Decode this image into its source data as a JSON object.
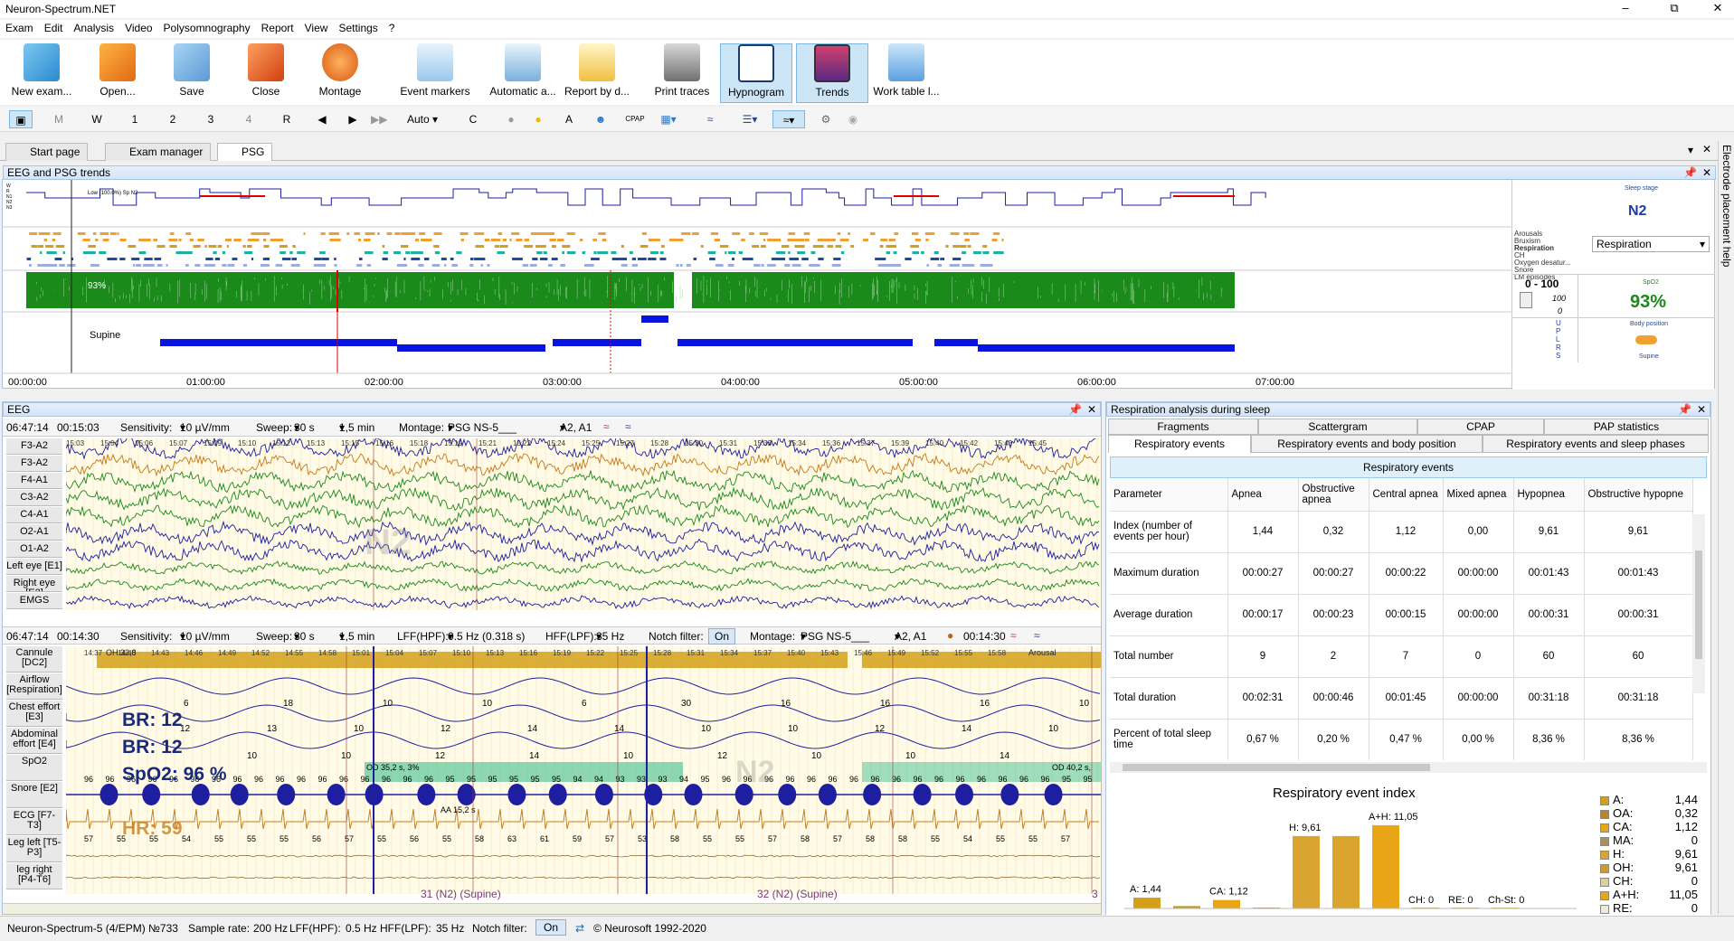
{
  "app": {
    "title": "Neuron-Spectrum.NET"
  },
  "menu": [
    "Exam",
    "Edit",
    "Analysis",
    "Video",
    "Polysomnography",
    "Report",
    "View",
    "Settings",
    "?"
  ],
  "ribbon": [
    {
      "label": "New exam...",
      "icon": "new-exam-icon"
    },
    {
      "label": "Open...",
      "icon": "open-icon"
    },
    {
      "label": "Save",
      "icon": "save-icon"
    },
    {
      "label": "Close",
      "icon": "close-exam-icon"
    },
    {
      "label": "Montage",
      "icon": "montage-icon"
    },
    {
      "label": "Event markers",
      "icon": "event-markers-icon"
    },
    {
      "label": "Automatic a...",
      "icon": "automatic-analysis-icon"
    },
    {
      "label": "Report by d...",
      "icon": "report-icon"
    },
    {
      "label": "Print traces",
      "icon": "printer-icon"
    },
    {
      "label": "Hypnogram",
      "icon": "hypnogram-icon"
    },
    {
      "label": "Trends",
      "icon": "trends-icon"
    },
    {
      "label": "Work table l...",
      "icon": "work-table-icon"
    }
  ],
  "toolbar2": {
    "m": "M",
    "w": "W",
    "n1": "1",
    "n2": "2",
    "n3": "3",
    "n4": "4",
    "r": "R",
    "auto": "Auto",
    "c": "C",
    "a": "A",
    "cpap": "CPAP"
  },
  "tabs": [
    "Start page",
    "Exam manager",
    "PSG"
  ],
  "trends": {
    "title": "EEG and PSG trends",
    "hypno_note": "Low (100.0%) Sp N2",
    "stage_label": "Sleep stage",
    "stage_value": "N2",
    "event_labels": [
      "Arousals",
      "Bruxism",
      "Respiration",
      "CH",
      "Oxygen desatur...",
      "Snore",
      "LM episodes"
    ],
    "event_dropdown": "Respiration",
    "spo2_range": "0 - 100",
    "spo2_top": "100",
    "spo2_bottom": "0",
    "spo2_label": "SpO2",
    "spo2_value": "93%",
    "spo2_marker": "93%",
    "position_marker": "Supine",
    "position_label": "Body position",
    "position_value": "Supine",
    "position_codes": "U P L R S",
    "time_axis": [
      "00:00:00",
      "01:00:00",
      "02:00:00",
      "03:00:00",
      "04:00:00",
      "05:00:00",
      "06:00:00",
      "07:00:00"
    ]
  },
  "eeg": {
    "title": "EEG",
    "toolbar1": {
      "time": "06:47:14",
      "dur": "00:15:03",
      "sens_label": "Sensitivity:",
      "sens": "10 µV/mm",
      "sweep_label": "Sweep:",
      "sweep": "30 s",
      "sweep2": "1,5 min",
      "montage_label": "Montage:",
      "montage": "PSG NS-5___",
      "ref": "A2, A1"
    },
    "channels1": [
      "F3-A2",
      "F3-A2",
      "F4-A1",
      "C3-A2",
      "C4-A1",
      "O2-A1",
      "O1-A2",
      "Left eye [E1]",
      "Right eye [E2]",
      "EMGS"
    ],
    "times1": [
      "15:03",
      "15:04",
      "15:06",
      "15:07",
      "15:09",
      "15:10",
      "15:12",
      "15:13",
      "15:15",
      "15:16",
      "15:18",
      "15:19",
      "15:21",
      "15:22",
      "15:24",
      "15:25",
      "15:27",
      "15:28",
      "15:30",
      "15:31",
      "15:33",
      "15:34",
      "15:36",
      "15:37",
      "15:39",
      "15:40",
      "15:42",
      "15:43",
      "15:45"
    ],
    "stage_overlay": "N2",
    "toolbar2": {
      "time": "06:47:14",
      "dur": "00:14:30",
      "sens_label": "Sensitivity:",
      "sens": "10 µV/mm",
      "sweep_label": "Sweep:",
      "sweep": "30 s",
      "sweep2": "1,5 min",
      "lff_label": "LFF(HPF):",
      "lff": "0.5 Hz (0.318 s)",
      "hff_label": "HFF(LPF):",
      "hff": "35 Hz",
      "notch_label": "Notch filter:",
      "notch": "On",
      "montage_label": "Montage:",
      "montage": "PSG NS-5___",
      "ref": "A2, A1",
      "clock": "00:14:30"
    },
    "channels2": [
      "Cannule [DC2]",
      "Airflow [Respiration]",
      "Chest effort [E3]",
      "Abdominal effort [E4]",
      "SpO2",
      "Snore [E2]",
      "ECG [F7-T3]",
      "Leg left [T5-P3]",
      "leg right [P4-T6]"
    ],
    "times2": [
      "14:37",
      "14:40",
      "14:43",
      "14:46",
      "14:49",
      "14:52",
      "14:55",
      "14:58",
      "15:01",
      "15:04",
      "15:07",
      "15:10",
      "15:13",
      "15:16",
      "15:19",
      "15:22",
      "15:25",
      "15:28",
      "15:31",
      "15:34",
      "15:37",
      "15:40",
      "15:43",
      "15:46",
      "15:49",
      "15:52",
      "15:55",
      "15:58"
    ],
    "br1": "BR: 12",
    "br2": "BR: 12",
    "spo2_overlay": "SpO2: 96 %",
    "hr_overlay": "HR: 59",
    "event_oh": "OH 32,8",
    "event_od": "OD 35,2 s, 3%",
    "event_od2": "OD 40,2 s,",
    "event_aa": "AA 15,2 s",
    "event_arousal": "Arousal",
    "epoch1": "31 (N2) (Supine)",
    "epoch2": "32 (N2) (Supine)",
    "epoch3": "3",
    "stage2_overlay": "N2",
    "spo2_vals": [
      "96",
      "96",
      "96",
      "96",
      "96",
      "96",
      "96",
      "96",
      "96",
      "96",
      "96",
      "96",
      "96",
      "96",
      "96",
      "96",
      "96",
      "95",
      "95",
      "95",
      "95",
      "95",
      "95",
      "94",
      "94",
      "93",
      "93",
      "93",
      "94",
      "95",
      "96",
      "96",
      "96",
      "96",
      "96",
      "96",
      "96",
      "96",
      "96",
      "96",
      "96",
      "96",
      "96",
      "96",
      "96",
      "96",
      "95",
      "95"
    ],
    "hr_vals": [
      "57",
      "55",
      "55",
      "54",
      "55",
      "55",
      "55",
      "56",
      "57",
      "55",
      "56",
      "55",
      "58",
      "63",
      "61",
      "59",
      "57",
      "53",
      "58",
      "55",
      "55",
      "57",
      "58",
      "57",
      "58",
      "58",
      "55",
      "54",
      "55",
      "55",
      "57"
    ],
    "flow_vals": [
      "6",
      "18",
      "10",
      "10",
      "6",
      "30",
      "16",
      "16",
      "16",
      "10"
    ],
    "chest_vals": [
      "12",
      "13",
      "10",
      "12",
      "14",
      "14",
      "10",
      "10",
      "12",
      "14",
      "10"
    ],
    "abd_vals": [
      "10",
      "10",
      "12",
      "14",
      "10",
      "12",
      "10",
      "10",
      "14"
    ]
  },
  "resp": {
    "title": "Respiration analysis during sleep",
    "tabs_row1": [
      "Fragments",
      "Scattergram",
      "CPAP",
      "PAP statistics"
    ],
    "tabs_row2": [
      "Respiratory events",
      "Respiratory events and body position",
      "Respiratory events and sleep phases"
    ],
    "table_title": "Respiratory events",
    "headers": [
      "Parameter",
      "Apnea",
      "Obstructive apnea",
      "Central apnea",
      "Mixed apnea",
      "Hypopnea",
      "Obstructive hypopne"
    ],
    "rows": [
      [
        "Index (number of events per hour)",
        "1,44",
        "0,32",
        "1,12",
        "0,00",
        "9,61",
        "9,61"
      ],
      [
        "Maximum duration",
        "00:00:27",
        "00:00:27",
        "00:00:22",
        "00:00:00",
        "00:01:43",
        "00:01:43"
      ],
      [
        "Average duration",
        "00:00:17",
        "00:00:23",
        "00:00:15",
        "00:00:00",
        "00:00:31",
        "00:00:31"
      ],
      [
        "Total number",
        "9",
        "2",
        "7",
        "0",
        "60",
        "60"
      ],
      [
        "Total duration",
        "00:02:31",
        "00:00:46",
        "00:01:45",
        "00:00:00",
        "00:31:18",
        "00:31:18"
      ],
      [
        "Percent of total sleep time",
        "0,67 %",
        "0,20 %",
        "0,47 %",
        "0,00 %",
        "8,36 %",
        "8,36 %"
      ]
    ],
    "chart_title": "Respiratory event index",
    "chart_data": {
      "type": "bar",
      "title": "Respiratory event index",
      "categories": [
        "A",
        "OA",
        "CA",
        "MA",
        "H",
        "OH",
        "A+H",
        "CH",
        "RE",
        "Ch-St"
      ],
      "values": [
        1.44,
        0.32,
        1.12,
        0,
        9.61,
        9.61,
        11.05,
        0,
        0,
        0
      ],
      "data_labels": [
        "A: 1,44",
        "",
        "CA: 1,12",
        "",
        "H: 9,61",
        "",
        "A+H: 11,05",
        "CH: 0",
        "RE: 0",
        "Ch-St: 0"
      ],
      "colors": [
        "#d4a017",
        "#c49a2a",
        "#e8a617",
        "#a89060",
        "#d9a530",
        "#dba42c",
        "#e8a617",
        "#c0a060",
        "#c8a870",
        "#e0b848"
      ],
      "ylim": [
        0,
        12
      ]
    },
    "legend": [
      {
        "key": "A:",
        "val": "1,44",
        "color": "#d4a017"
      },
      {
        "key": "OA:",
        "val": "0,32",
        "color": "#b8862a"
      },
      {
        "key": "CA:",
        "val": "1,12",
        "color": "#e8a617"
      },
      {
        "key": "MA:",
        "val": "0",
        "color": "#a89060"
      },
      {
        "key": "H:",
        "val": "9,61",
        "color": "#d9a530"
      },
      {
        "key": "OH:",
        "val": "9,61",
        "color": "#cf9b2c"
      },
      {
        "key": "CH:",
        "val": "0",
        "color": "#ddd0a0"
      },
      {
        "key": "A+H:",
        "val": "11,05",
        "color": "#e8a617"
      },
      {
        "key": "RE:",
        "val": "0",
        "color": "#f0e8d8"
      }
    ]
  },
  "status": {
    "device": "Neuron-Spectrum-5 (4/EPM) №733",
    "rate_label": "Sample rate:",
    "rate": "200 Hz",
    "lff_label": "LFF(HPF):",
    "lff": "0.5 Hz",
    "hff_label": "HFF(LPF):",
    "hff": "35 Hz",
    "notch_label": "Notch filter:",
    "notch": "On",
    "copyright": "© Neurosoft 1992-2020"
  },
  "side_help": "Electrode placement help",
  "colors": {
    "accent": "#0a5fb4",
    "panel_border": "#a9c3e3",
    "trace_green": "#1a8a1a",
    "trace_blue": "#1e1ea0",
    "trace_orange": "#c87814",
    "spo2_green": "#1a8a1a",
    "position_blue": "#0a14e0",
    "hypno_red": "#e00000"
  }
}
